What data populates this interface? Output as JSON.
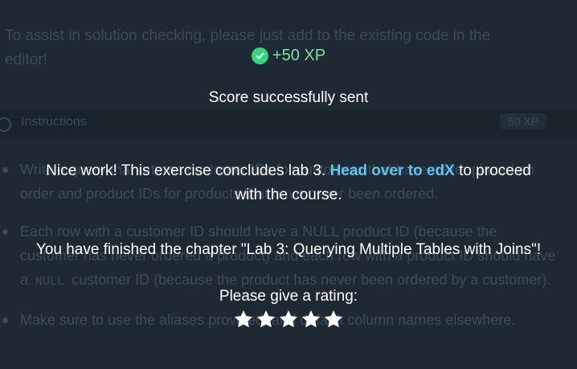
{
  "background": {
    "context_text": "To assist in solution checking, please just add to the existing code in the editor!",
    "instructions_title": "Instructions",
    "xp_badge": "50 XP",
    "items": [
      {
        "before": "Write a query that returns customer IDs for customers that have never placed an order and product IDs for products that have never been ordered.",
        "code": "",
        "after": ""
      },
      {
        "before": "Each row with a customer ID should have a NULL product ID (because the customer has never ordered a product) and each row with a product ID should have a",
        "code": "NULL",
        "after": "customer ID (because the product has never been ordered by a customer)."
      },
      {
        "before": "Make sure to use the aliases provided, and default column names elsewhere.",
        "code": "",
        "after": ""
      }
    ]
  },
  "modal": {
    "xp_label": "+50 XP",
    "score_message": "Score successfully sent",
    "nice_work_text": "Nice work! This exercise concludes lab 3.",
    "link_text": "Head over to edX",
    "after_link_text": "to proceed with the course.",
    "chapter_message": "You have finished the chapter \"Lab 3: Querying Multiple Tables with Joins\"!",
    "rating_prompt": "Please give a rating:",
    "star_count": 5,
    "colors": {
      "check": "#36d57d",
      "xp_text": "#7ee0a4",
      "link": "#5fc4ef",
      "star": "#ffffff"
    },
    "icons": [
      "check-circle-icon",
      "star-icon"
    ]
  }
}
